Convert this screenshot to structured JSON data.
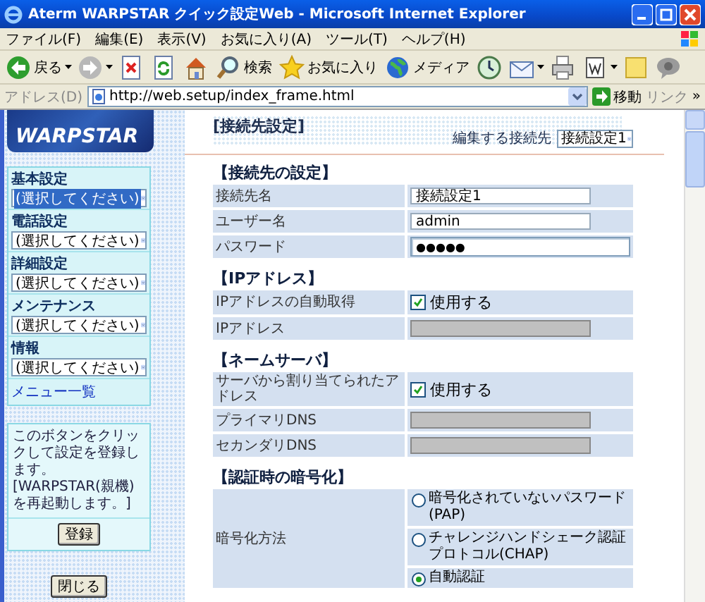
{
  "window": {
    "title": "Aterm WARPSTAR クイック設定Web - Microsoft Internet Explorer"
  },
  "menu_bar": [
    "ファイル(F)",
    "編集(E)",
    "表示(V)",
    "お気に入り(A)",
    "ツール(T)",
    "ヘルプ(H)"
  ],
  "toolbar": [
    {
      "kind": "back",
      "label": "戻る",
      "dropdown": true
    },
    {
      "kind": "forward",
      "dropdown": true
    },
    {
      "kind": "stop",
      "dropdown": false
    },
    {
      "kind": "refresh",
      "dropdown": false
    },
    {
      "kind": "home",
      "dropdown": false
    },
    {
      "kind": "search",
      "label": "検索",
      "dropdown": false
    },
    {
      "kind": "favorites",
      "label": "お気に入り",
      "dropdown": false
    },
    {
      "kind": "media",
      "label": "メディア",
      "dropdown": false
    },
    {
      "kind": "history",
      "dropdown": false
    },
    {
      "kind": "mail",
      "dropdown": true
    },
    {
      "kind": "print",
      "dropdown": false
    },
    {
      "kind": "edit",
      "dropdown": true
    },
    {
      "kind": "note",
      "dropdown": false
    },
    {
      "kind": "messenger",
      "dropdown": false
    }
  ],
  "address_bar": {
    "label": "アドレス(D)",
    "url": "http://web.setup/index_frame.html",
    "go": "移動",
    "links": "リンク",
    "more": "»"
  },
  "sidebar": {
    "logo": "WARPSTAR",
    "menus": [
      {
        "label": "基本設定",
        "value": "(選択してください)",
        "selected": true
      },
      {
        "label": "電話設定",
        "value": "(選択してください)",
        "selected": false
      },
      {
        "label": "詳細設定",
        "value": "(選択してください)",
        "selected": false
      },
      {
        "label": "メンテナンス",
        "value": "(選択してください)",
        "selected": false
      },
      {
        "label": "情報",
        "value": "(選択してください)",
        "selected": false
      }
    ],
    "menu_list_link": "メニュー一覧",
    "register_note": "このボタンをクリックして設定を登録します。[WARPSTAR(親機)を再起動します。]",
    "register_button": "登録",
    "close_button": "閉じる"
  },
  "main": {
    "title": "[接続先設定]",
    "edit_target": {
      "label": "編集する接続先",
      "value": "接続設定1"
    },
    "sections": [
      {
        "heading": "【接続先の設定】",
        "rows": [
          {
            "label": "接続先名",
            "kind": "text",
            "value": "接続設定1"
          },
          {
            "label": "ユーザー名",
            "kind": "text",
            "value": "admin"
          },
          {
            "label": "パスワード",
            "kind": "password",
            "value": "●●●●●"
          }
        ]
      },
      {
        "heading": "【IPアドレス】",
        "rows": [
          {
            "label": "IPアドレスの自動取得",
            "kind": "checkbox",
            "value": "使用する",
            "checked": true
          },
          {
            "label": "IPアドレス",
            "kind": "disabled"
          }
        ]
      },
      {
        "heading": "【ネームサーバ】",
        "rows": [
          {
            "label": "サーバから割り当てられたアドレス",
            "kind": "checkbox",
            "value": "使用する",
            "checked": true
          },
          {
            "label": "プライマリDNS",
            "kind": "disabled"
          },
          {
            "label": "セカンダリDNS",
            "kind": "disabled"
          }
        ]
      },
      {
        "heading": "【認証時の暗号化】",
        "rows": [
          {
            "label": "暗号化方法",
            "kind": "radio_group",
            "options": [
              {
                "label": "暗号化されていないパスワード(PAP)",
                "selected": false
              },
              {
                "label": "チャレンジハンドシェーク認証プロトコル(CHAP)",
                "selected": false
              },
              {
                "label": "自動認証",
                "selected": true
              }
            ]
          }
        ]
      }
    ]
  }
}
